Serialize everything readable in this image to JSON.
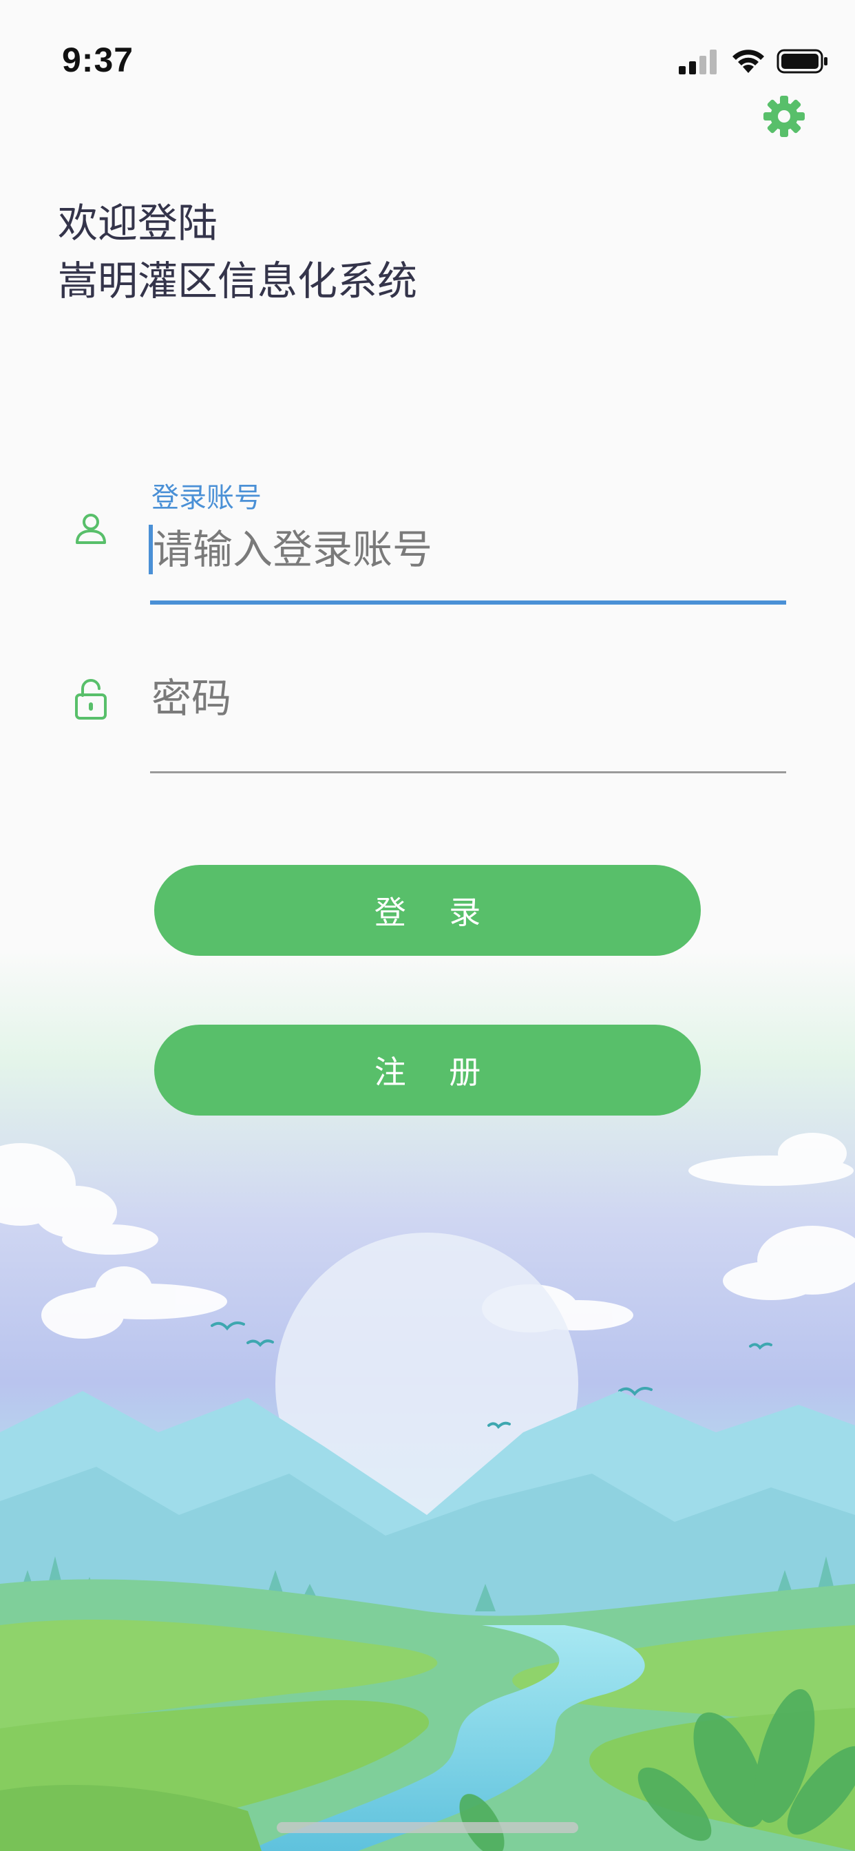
{
  "status_bar": {
    "time": "9:37",
    "icons": [
      "signal-icon",
      "wifi-icon",
      "battery-icon"
    ]
  },
  "header": {
    "settings_icon": "gear-icon"
  },
  "welcome": {
    "line1": "欢迎登陆",
    "line2": "嵩明灌区信息化系统"
  },
  "form": {
    "account": {
      "icon": "user-icon",
      "label": "登录账号",
      "placeholder": "请输入登录账号",
      "value": ""
    },
    "password": {
      "icon": "lock-icon",
      "placeholder": "密码",
      "value": ""
    }
  },
  "buttons": {
    "login_label": "登 录",
    "register_label": "注 册"
  },
  "colors": {
    "accent": "#58bf6a",
    "focus": "#4a90d6",
    "text": "#34344a"
  }
}
